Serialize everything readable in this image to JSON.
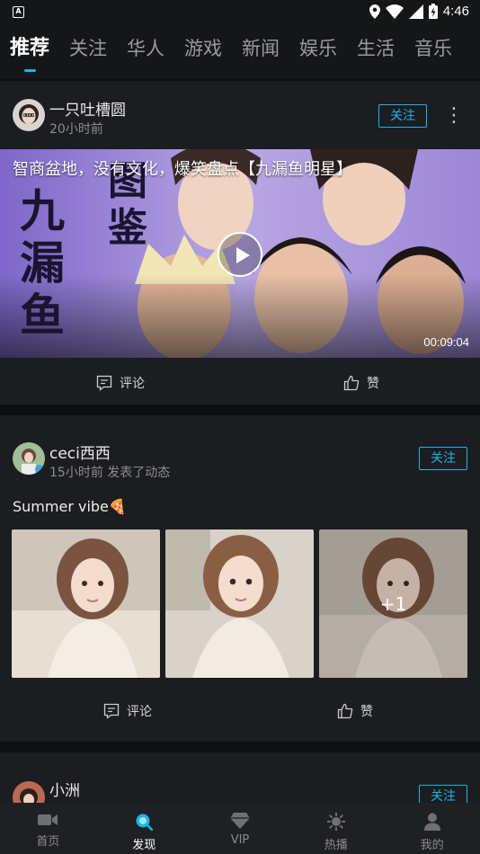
{
  "status_bar": {
    "time": "4:46",
    "app_badge": "A"
  },
  "tabs": [
    {
      "label": "推荐",
      "active": true
    },
    {
      "label": "关注"
    },
    {
      "label": "华人"
    },
    {
      "label": "游戏"
    },
    {
      "label": "新闻"
    },
    {
      "label": "娱乐"
    },
    {
      "label": "生活"
    },
    {
      "label": "音乐"
    }
  ],
  "posts": [
    {
      "author": "一只吐槽圆",
      "meta": "20小时前",
      "follow_label": "关注",
      "video_title": "智商盆地，没有文化，爆笑盘点【九漏鱼明星】",
      "video_overlay_text": [
        "九",
        "漏",
        "鱼",
        "图",
        "鉴"
      ],
      "duration": "00:09:04",
      "comment_label": "评论",
      "like_label": "赞"
    },
    {
      "author": "ceci西西",
      "meta": "15小时前  发表了动态",
      "follow_label": "关注",
      "text": "Summer vibe🍕",
      "extra_photos": "+1",
      "comment_label": "评论",
      "like_label": "赞"
    },
    {
      "author": "小洲",
      "follow_label": "关注"
    }
  ],
  "bottom_nav": [
    {
      "label": "首页",
      "icon": "video-camera-icon"
    },
    {
      "label": "发现",
      "icon": "discover-search-icon",
      "active": true
    },
    {
      "label": "VIP",
      "icon": "diamond-icon"
    },
    {
      "label": "热播",
      "icon": "sun-icon"
    },
    {
      "label": "我的",
      "icon": "person-icon"
    }
  ],
  "colors": {
    "accent": "#19b6e8",
    "background": "#151618",
    "card": "#1c1d20"
  }
}
